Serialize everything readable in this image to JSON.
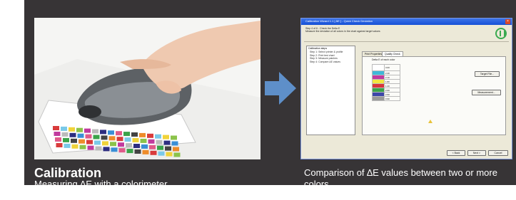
{
  "captions": {
    "left_title": "Calibration",
    "left_subtitle": "Measuring ∆E with a colorimeter.",
    "right_text": "Comparison of ∆E values between two or more colors."
  },
  "photo": {
    "subject": "hand holding colorimeter over color test chart"
  },
  "software": {
    "window_title": "Calibration Wizard 1.1 [ ∆E ] - Quick Check Deviation",
    "close_symbol": "×",
    "intro_lines": [
      "Step 4 of 6 - Check the Delta E",
      "Measure the deviation of all colors in the chart against target values"
    ],
    "list_header": "Calibration steps",
    "list_items": [
      "Step 1: Select printer & profile",
      "Step 2: Print test chart",
      "Step 3: Measure patches",
      "Step 4: Compare ∆E values"
    ],
    "tabs": [
      "Print Properties",
      "Quality Check"
    ],
    "chart_title": "Delta E of each color",
    "colors": [
      {
        "name": "Max. Delta E",
        "swatch": "#ffffff",
        "value": "3.00"
      },
      {
        "name": "Cyan",
        "swatch": "#3fb8d8",
        "value": "2.40"
      },
      {
        "name": "Magenta",
        "swatch": "#c13a9e",
        "value": "2.10"
      },
      {
        "name": "Yellow",
        "swatch": "#f2e640",
        "value": "1.80"
      },
      {
        "name": "Red",
        "swatch": "#d8363a",
        "value": "1.20"
      },
      {
        "name": "Green",
        "swatch": "#3aa34a",
        "value": "2.60"
      },
      {
        "name": "Blue",
        "swatch": "#3d46a8",
        "value": "2.50"
      },
      {
        "name": "CMYK Gray",
        "swatch": "#9a9a9a",
        "value": "0.90"
      }
    ],
    "buttons": {
      "target_file": "Target File...",
      "measurement": "Measurement...",
      "back": "< Back",
      "next": "Next >",
      "cancel": "Cancel"
    }
  },
  "colors": {
    "panel": "#373436",
    "arrow": "#5e8fc9",
    "titlebar": "#1f5cd9",
    "dialog": "#ece9d8"
  }
}
